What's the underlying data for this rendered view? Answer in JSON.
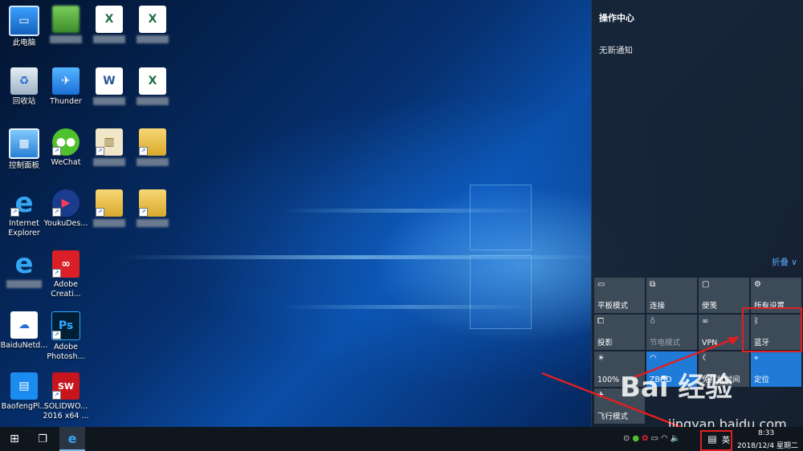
{
  "desktop": {
    "icons": [
      {
        "label": "此电脑",
        "icon": "computer-icon"
      },
      {
        "label": "",
        "icon": "blurred-app-icon"
      },
      {
        "label": "",
        "icon": "excel-icon"
      },
      {
        "label": "",
        "icon": "excel-icon"
      },
      {
        "label": "回收站",
        "icon": "recycle-bin-icon"
      },
      {
        "label": "Thunder",
        "icon": "thunder-icon"
      },
      {
        "label": "",
        "icon": "word-icon"
      },
      {
        "label": "",
        "icon": "excel-icon"
      },
      {
        "label": "控制面板",
        "icon": "control-panel-icon"
      },
      {
        "label": "WeChat",
        "icon": "wechat-icon"
      },
      {
        "label": "",
        "icon": "document-icon"
      },
      {
        "label": "",
        "icon": "folder-icon"
      },
      {
        "label": "Internet Explorer",
        "icon": "ie-icon"
      },
      {
        "label": "YoukuDes...",
        "icon": "youku-icon"
      },
      {
        "label": "",
        "icon": "folder-icon"
      },
      {
        "label": "",
        "icon": "folder-icon"
      },
      {
        "label": "",
        "icon": "ie-icon"
      },
      {
        "label": "Adobe Creati...",
        "icon": "adobe-cc-icon"
      },
      {
        "label": "BaiduNetd...",
        "icon": "baidu-netdisk-icon"
      },
      {
        "label": "Adobe Photosh...",
        "icon": "photoshop-icon"
      },
      {
        "label": "BaofengPl...",
        "icon": "baofeng-icon"
      },
      {
        "label": "SOLIDWO... 2016 x64 ...",
        "icon": "solidworks-icon"
      }
    ]
  },
  "action_center": {
    "title": "操作中心",
    "empty_text": "无新通知",
    "collapse_label": "折叠 ∨",
    "tiles": [
      {
        "label": "平板模式",
        "icon": "tablet-mode-icon",
        "state": "off"
      },
      {
        "label": "连接",
        "icon": "connect-icon",
        "state": "off"
      },
      {
        "label": "便笺",
        "icon": "note-icon",
        "state": "off"
      },
      {
        "label": "所有设置",
        "icon": "settings-icon",
        "state": "off"
      },
      {
        "label": "投影",
        "icon": "project-icon",
        "state": "off"
      },
      {
        "label": "节电模式",
        "icon": "battery-saver-icon",
        "state": "disabled"
      },
      {
        "label": "VPN",
        "icon": "vpn-icon",
        "state": "off"
      },
      {
        "label": "蓝牙",
        "icon": "bluetooth-icon",
        "state": "off"
      },
      {
        "label": "100%",
        "icon": "brightness-icon",
        "state": "off"
      },
      {
        "label": "ZBGD",
        "icon": "wifi-icon",
        "state": "on"
      },
      {
        "label": "免打扰时间",
        "icon": "quiet-hours-icon",
        "state": "off"
      },
      {
        "label": "定位",
        "icon": "location-icon",
        "state": "on"
      },
      {
        "label": "飞行模式",
        "icon": "airplane-icon",
        "state": "off"
      }
    ]
  },
  "taskbar": {
    "input_lang": "英",
    "clock_time": "8:33",
    "clock_date": "2018/12/4 星期二"
  },
  "watermark": {
    "brand": "Bai 经验",
    "url": "jingyan.baidu.com"
  },
  "colors": {
    "accent": "#1f7ad8",
    "tile": "#3d4a58",
    "annotation": "#e02020"
  }
}
